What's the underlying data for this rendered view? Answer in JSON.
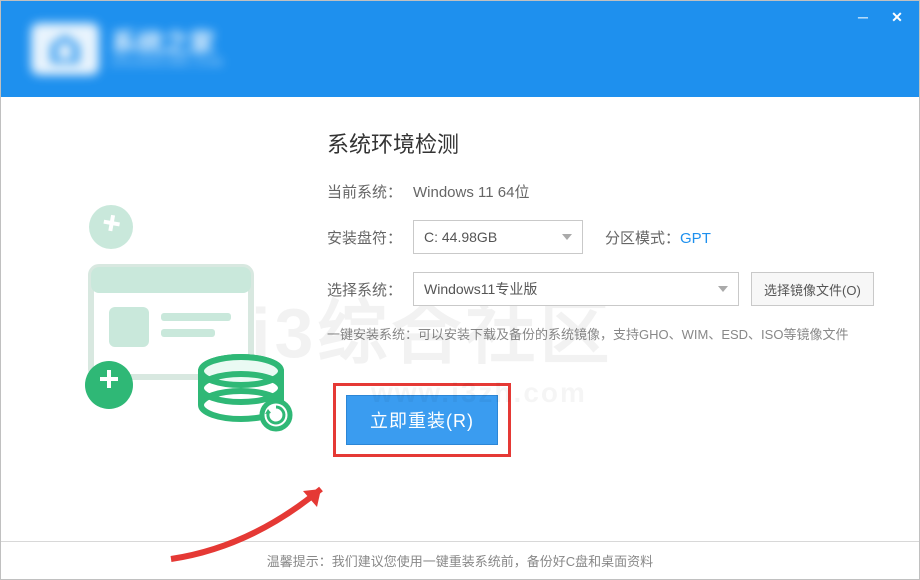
{
  "brand": {
    "name": "系统之家",
    "sub": "ZHUANGJIBA.COM"
  },
  "page": {
    "title": "系统环境检测",
    "current_label": "当前系统：",
    "current_value": "Windows 11 64位",
    "drive_label": "安装盘符：",
    "drive_value": "C: 44.98GB",
    "partition_label": "分区模式：",
    "partition_value": "GPT",
    "system_label": "选择系统：",
    "system_value": "Windows11专业版",
    "choose_iso": "选择镜像文件(O)",
    "help": "一键安装系统：可以安装下载及备份的系统镜像，支持GHO、WIM、ESD、ISO等镜像文件",
    "action": "立即重装(R)"
  },
  "footer": "温馨提示：我们建议您使用一键重装系统前，备份好C盘和桌面资料",
  "watermark": "i3综合社区",
  "watermark_sub": "www.i3zh.com"
}
